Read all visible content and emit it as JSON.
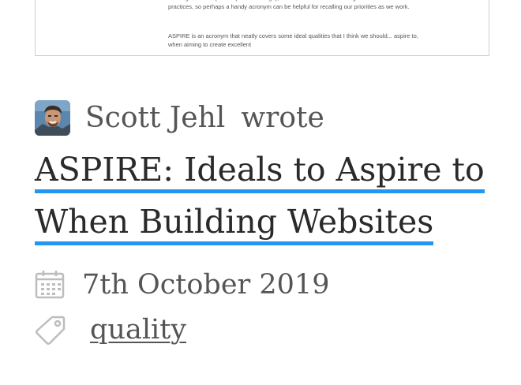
{
  "preview": {
    "paragraph1": "building of others (like responsive design), these ideas are made through a combination of best practices, so perhaps a handy acronym can be helpful for recalling our priorities as we work.",
    "paragraph2": "ASPIRE is an acronym that neatly covers some ideal qualities that I think we should... aspire to, when aiming to create excellent"
  },
  "author": {
    "name": "Scott Jehl",
    "action": "wrote"
  },
  "post": {
    "title": "ASPIRE: Ideals to Aspire to When Building Websites",
    "date": "7th October 2019",
    "tag": "quality"
  },
  "icons": {
    "date": "calendar-icon",
    "tag": "tag-icon"
  },
  "colors": {
    "link_underline": "#2196f3",
    "meta_text": "#555555",
    "title_text": "#2a2a2a"
  }
}
